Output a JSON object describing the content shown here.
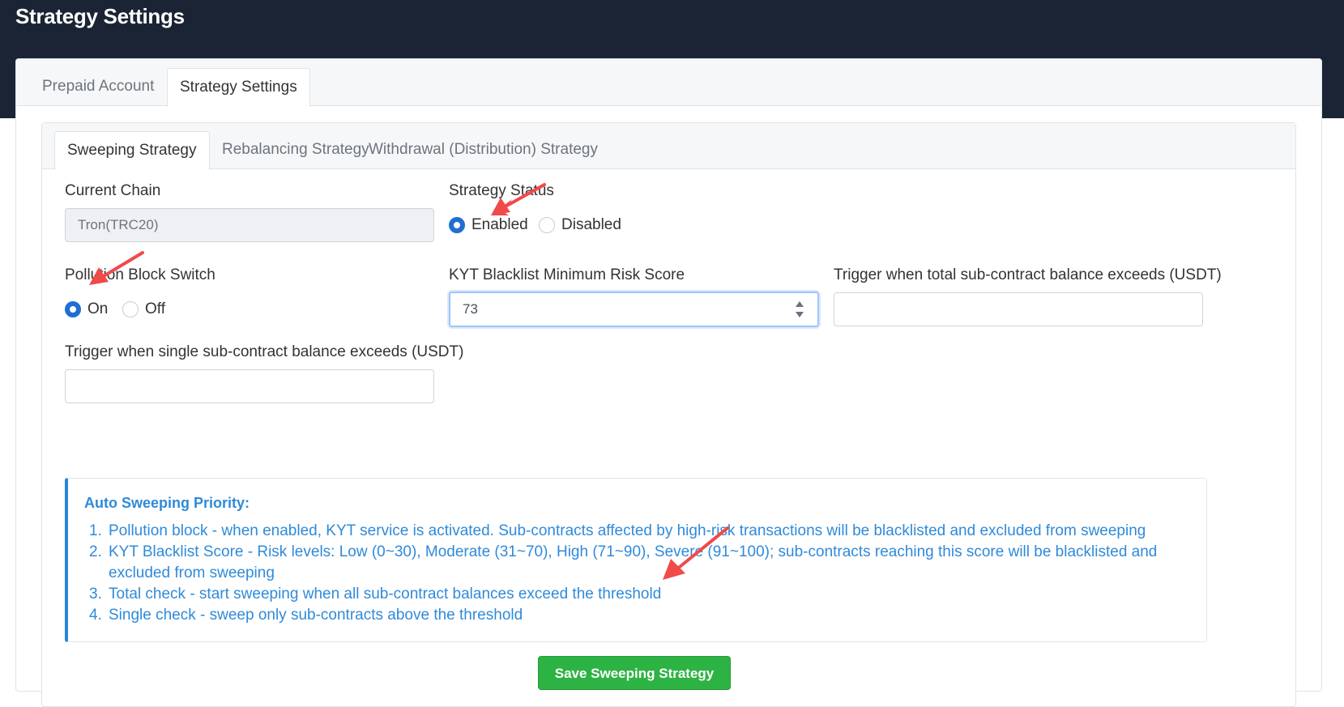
{
  "page": {
    "title": "Strategy Settings"
  },
  "main_tabs": [
    {
      "label": "Prepaid Account",
      "active": false
    },
    {
      "label": "Strategy Settings",
      "active": true
    }
  ],
  "sub_tabs": [
    {
      "label": "Sweeping Strategy",
      "active": true
    },
    {
      "label": "Rebalancing Strategy",
      "active": false
    },
    {
      "label": "Withdrawal (Distribution) Strategy",
      "active": false
    }
  ],
  "form": {
    "current_chain": {
      "label": "Current Chain",
      "value": "Tron(TRC20)"
    },
    "strategy_status": {
      "label": "Strategy Status",
      "options": [
        "Enabled",
        "Disabled"
      ],
      "selected": "Enabled"
    },
    "pollution_block": {
      "label": "Pollution Block Switch",
      "options": [
        "On",
        "Off"
      ],
      "selected": "On"
    },
    "kyt_score": {
      "label": "KYT Blacklist Minimum Risk Score",
      "value": "73"
    },
    "total_trigger": {
      "label": "Trigger when total sub-contract balance exceeds (USDT)",
      "value": ""
    },
    "single_trigger": {
      "label": "Trigger when single sub-contract balance exceeds (USDT)",
      "value": ""
    }
  },
  "info": {
    "title": "Auto Sweeping Priority:",
    "items": [
      {
        "num": "1.",
        "text": "Pollution block - when enabled, KYT service is activated. Sub-contracts affected by high-risk transactions will be blacklisted and excluded from sweeping"
      },
      {
        "num": "2.",
        "text": "KYT Blacklist Score - Risk levels: Low (0~30), Moderate (31~70), High (71~90), Severe (91~100); sub-contracts reaching this score will be blacklisted and excluded from sweeping"
      },
      {
        "num": "3.",
        "text": "Total check - start sweeping when all sub-contract balances exceed the threshold"
      },
      {
        "num": "4.",
        "text": "Single check - sweep only sub-contracts above the threshold"
      }
    ]
  },
  "actions": {
    "save_label": "Save Sweeping Strategy"
  },
  "colors": {
    "accent": "#1f6fd1",
    "info": "#2f8ad9",
    "save": "#2db344",
    "header": "#1b2434",
    "arrow": "#f04a4a"
  }
}
